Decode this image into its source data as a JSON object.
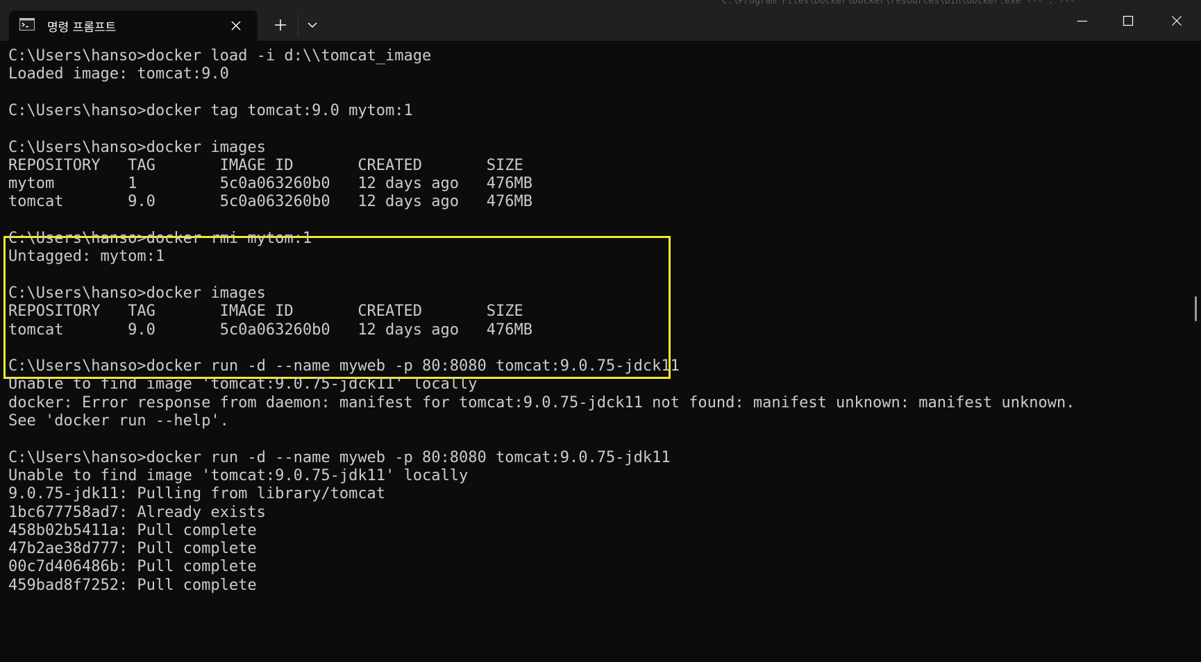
{
  "window": {
    "tab_title": "명령 프롬프트",
    "background_text": "C:\\Program Files\\Docker\\Docker\\resources\\bin\\docker.exe  ---  :  ---"
  },
  "colors": {
    "terminal_bg": "#0c0c0c",
    "terminal_fg": "#cccccc",
    "titlebar_bg": "#202020",
    "highlight_border": "#f5e92a"
  },
  "icons": {
    "tab": "cmd-icon",
    "tab_close": "close-icon",
    "new_tab": "plus-icon",
    "dropdown": "chevron-down-icon",
    "minimize": "minimize-icon",
    "maximize": "maximize-icon",
    "close": "close-icon"
  },
  "terminal": {
    "lines": [
      "C:\\Users\\hanso>docker load -i d:\\\\tomcat_image",
      "Loaded image: tomcat:9.0",
      "",
      "C:\\Users\\hanso>docker tag tomcat:9.0 mytom:1",
      "",
      "C:\\Users\\hanso>docker images",
      "REPOSITORY   TAG       IMAGE ID       CREATED       SIZE",
      "mytom        1         5c0a063260b0   12 days ago   476MB",
      "tomcat       9.0       5c0a063260b0   12 days ago   476MB",
      "",
      "C:\\Users\\hanso>docker rmi mytom:1",
      "Untagged: mytom:1",
      "",
      "C:\\Users\\hanso>docker images",
      "REPOSITORY   TAG       IMAGE ID       CREATED       SIZE",
      "tomcat       9.0       5c0a063260b0   12 days ago   476MB",
      "",
      "C:\\Users\\hanso>docker run -d --name myweb -p 80:8080 tomcat:9.0.75-jdck11",
      "Unable to find image 'tomcat:9.0.75-jdck11' locally",
      "docker: Error response from daemon: manifest for tomcat:9.0.75-jdck11 not found: manifest unknown: manifest unknown.",
      "See 'docker run --help'.",
      "",
      "C:\\Users\\hanso>docker run -d --name myweb -p 80:8080 tomcat:9.0.75-jdk11",
      "Unable to find image 'tomcat:9.0.75-jdk11' locally",
      "9.0.75-jdk11: Pulling from library/tomcat",
      "1bc677758ad7: Already exists",
      "458b02b5411a: Pull complete",
      "47b2ae38d777: Pull complete",
      "00c7d406486b: Pull complete",
      "459bad8f7252: Pull complete"
    ]
  }
}
